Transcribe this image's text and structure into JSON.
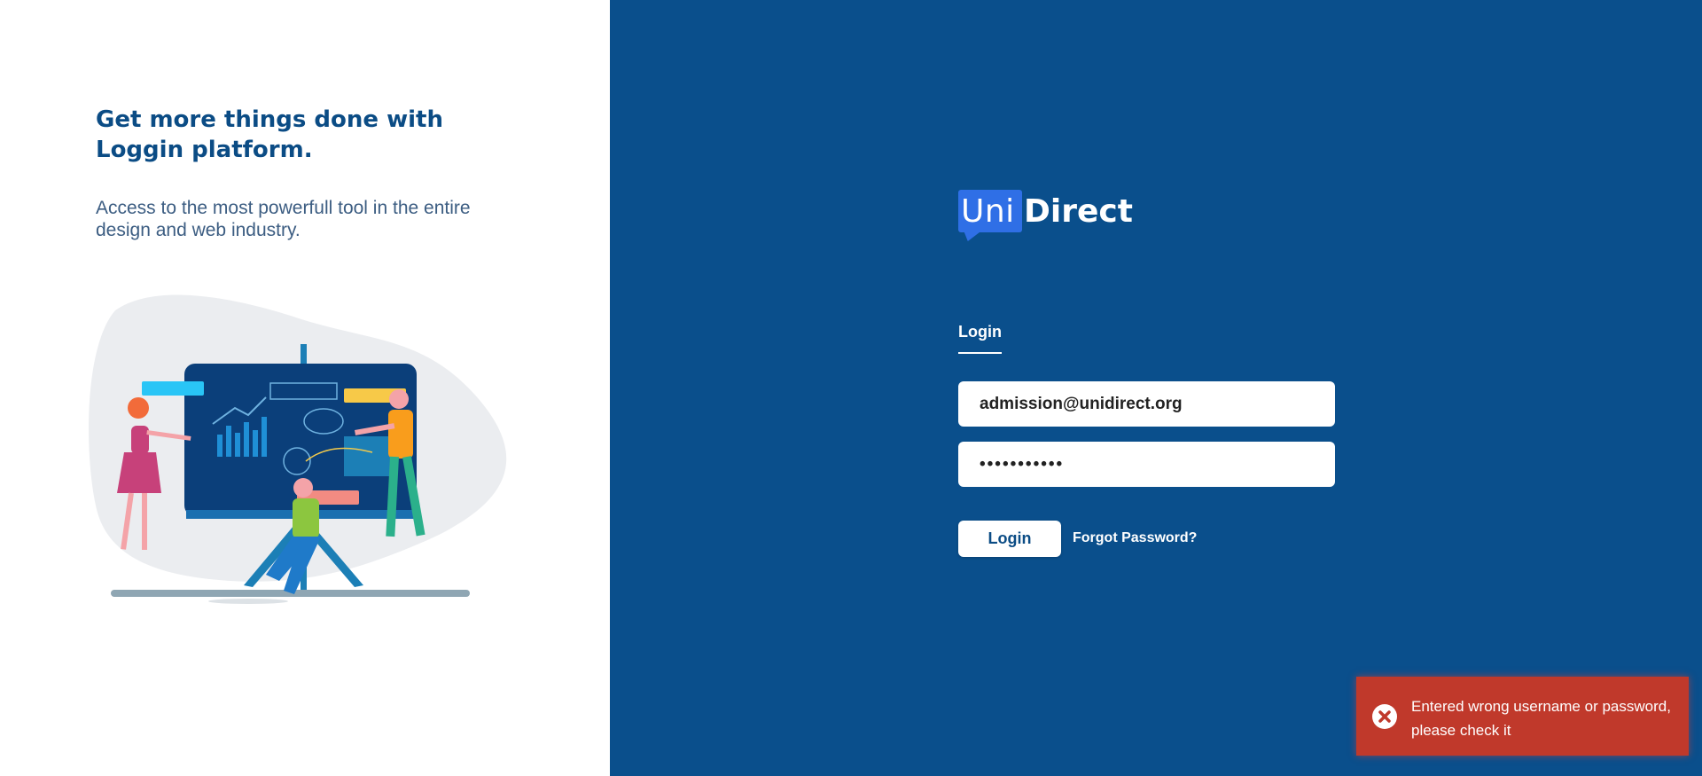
{
  "left": {
    "headline": "Get more things done with Loggin platform.",
    "subtext": "Access to the most powerfull tool in the entire design and web industry.",
    "illustration_icon": "team-presentation-illustration"
  },
  "logo": {
    "uni": "Uni",
    "direct": "Direct",
    "icon": "speech-bubble-logo"
  },
  "login_form": {
    "tab_label": "Login",
    "email_value": "admission@unidirect.org",
    "password_value": "•••••••••••",
    "login_button": "Login",
    "forgot_link": "Forgot Password?"
  },
  "toast": {
    "message": "Entered wrong username or password, please check it",
    "icon": "error-x-circle-icon",
    "color": "#c0392b"
  },
  "colors": {
    "brand_blue": "#0a4f8c",
    "logo_blue": "#2f6fe6",
    "heading_blue": "#0b4c85"
  }
}
